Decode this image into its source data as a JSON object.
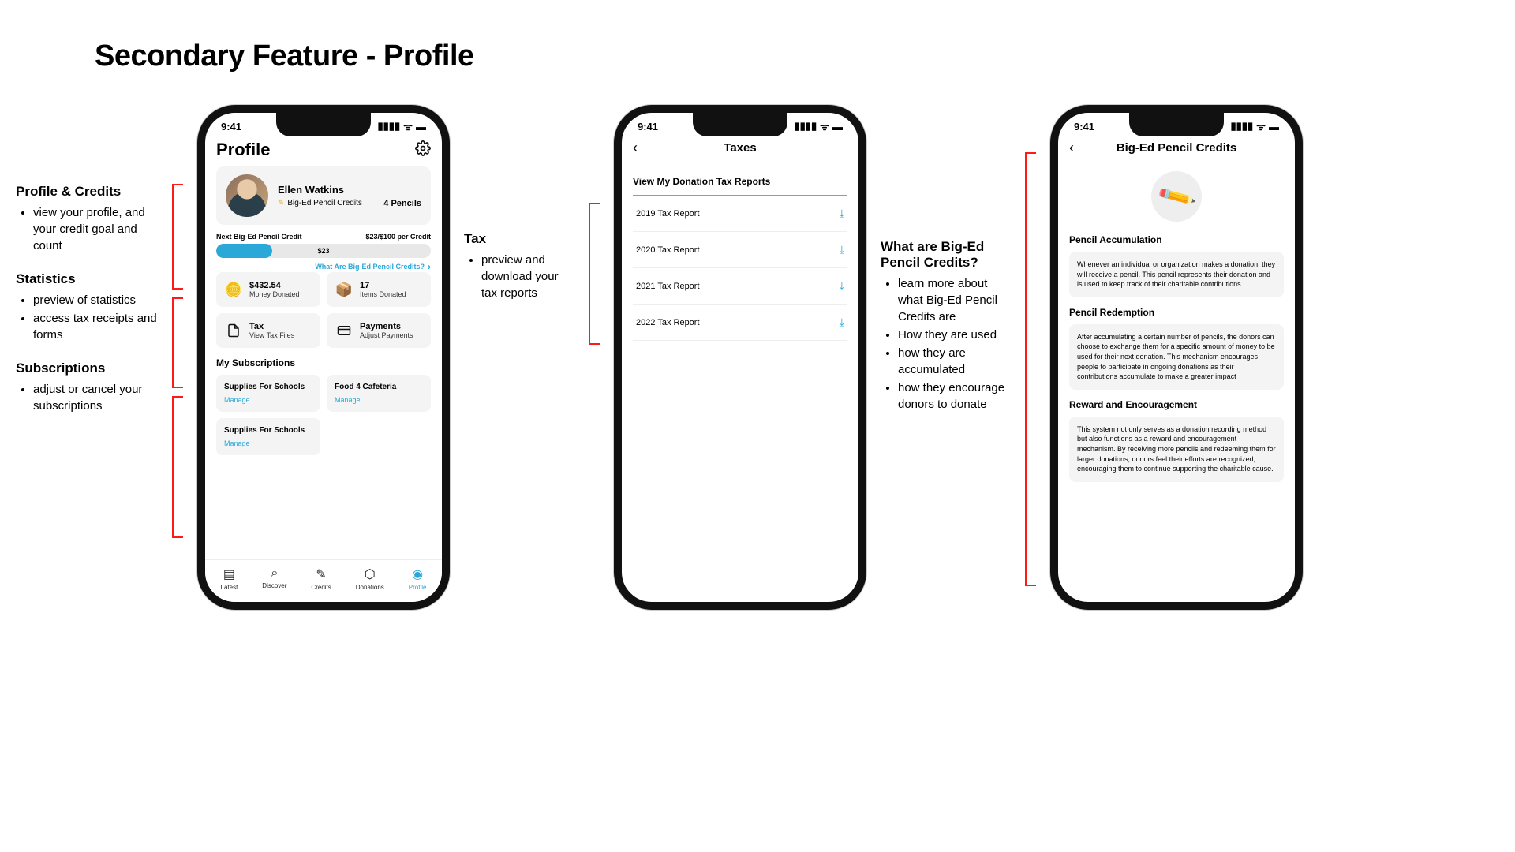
{
  "slide_title": "Secondary Feature - Profile",
  "annotations_left": [
    {
      "title": "Profile & Credits",
      "bullets": [
        "view your profile, and your credit goal and count"
      ]
    },
    {
      "title": "Statistics",
      "bullets": [
        "preview of statistics",
        "access tax receipts and forms"
      ]
    },
    {
      "title": "Subscriptions",
      "bullets": [
        "adjust or cancel your subscriptions"
      ]
    }
  ],
  "annotation_tax": {
    "title": "Tax",
    "bullets": [
      "preview and download your tax reports"
    ]
  },
  "annotation_credits": {
    "title": "What are Big-Ed Pencil Credits?",
    "bullets": [
      "learn more about what Big-Ed Pencil Credits are",
      "How they are used",
      "how they are accumulated",
      "how they encourage donors to donate"
    ]
  },
  "status_time": "9:41",
  "profile_screen": {
    "header": "Profile",
    "user_name": "Ellen Watkins",
    "credits_label": "Big-Ed Pencil Credits",
    "credits_count": "4 Pencils",
    "next_label": "Next Big-Ed Pencil Credit",
    "per_credit": "$23/$100 per Credit",
    "progress_value": "$23",
    "what_are_link": "What Are Big-Ed Pencil Credits?",
    "stats": {
      "money_val": "$432.54",
      "money_lbl": "Money Donated",
      "items_val": "17",
      "items_lbl": "Items Donated",
      "tax_val": "Tax",
      "tax_lbl": "View Tax Files",
      "pay_val": "Payments",
      "pay_lbl": "Adjust Payments"
    },
    "subs_title": "My Subscriptions",
    "subs": [
      {
        "name": "Supplies For Schools",
        "action": "Manage"
      },
      {
        "name": "Food 4 Cafeteria",
        "action": "Manage"
      },
      {
        "name": "Supplies For Schools",
        "action": "Manage"
      }
    ],
    "tabs": [
      "Latest",
      "Discover",
      "Credits",
      "Donations",
      "Profile"
    ]
  },
  "taxes_screen": {
    "header": "Taxes",
    "section": "View My Donation Tax Reports",
    "reports": [
      "2019 Tax Report",
      "2020 Tax Report",
      "2021 Tax Report",
      "2022 Tax Report"
    ]
  },
  "credits_screen": {
    "header": "Big-Ed Pencil Credits",
    "sections": {
      "s1_title": "Pencil Accumulation",
      "s1_body": "Whenever an individual or organization makes a donation, they will receive a pencil. This pencil represents their donation and is used to keep track of their charitable contributions.",
      "s2_title": "Pencil Redemption",
      "s2_body": "After accumulating a certain number of pencils, the donors can choose to exchange them for a specific amount of money to be used for their next donation. This mechanism encourages people to participate in ongoing donations as their contributions accumulate to make a greater impact",
      "s3_title": "Reward and Encouragement",
      "s3_body": "This system not only serves as a donation recording method but also functions as a reward and encouragement mechanism. By receiving more pencils and redeeming them for larger donations, donors feel their efforts are recognized, encouraging them to continue supporting the charitable cause."
    }
  }
}
